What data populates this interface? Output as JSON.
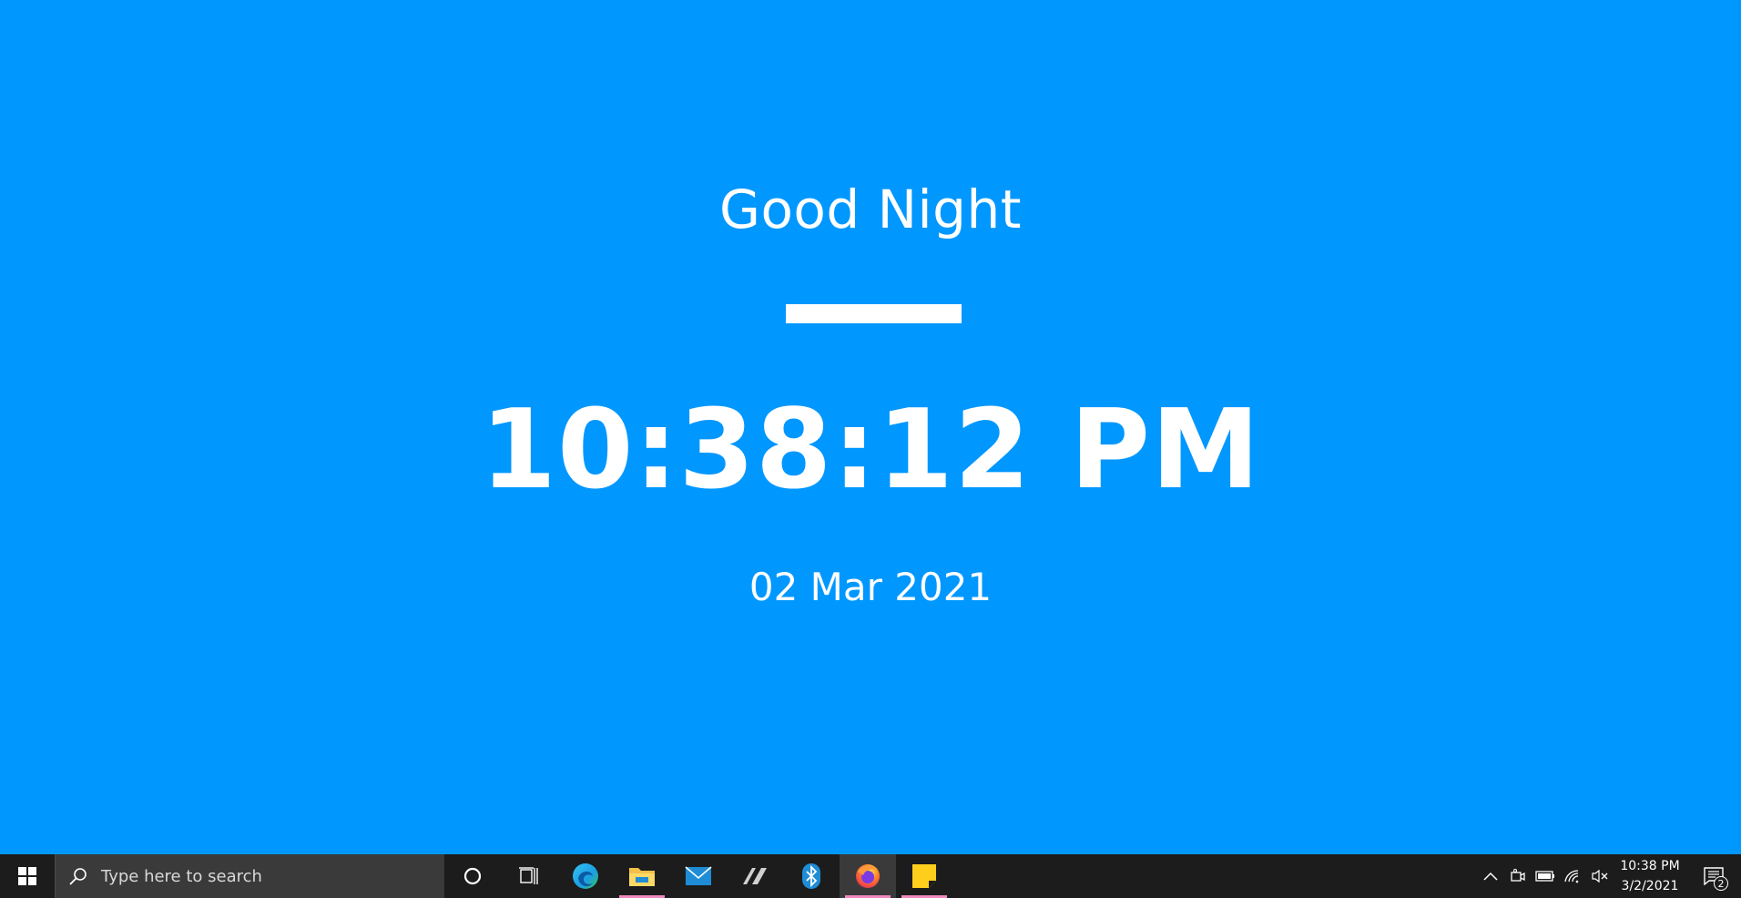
{
  "clock_app": {
    "greeting": "Good Night",
    "time": "10:38:12 PM",
    "date": "02 Mar 2021",
    "background_color": "#0097FF",
    "text_color": "#FFFFFF"
  },
  "taskbar": {
    "search_placeholder": "Type here to search",
    "pinned_apps": [
      {
        "name": "Cortana",
        "icon": "cortana-circle-icon",
        "running": false
      },
      {
        "name": "Task View",
        "icon": "task-view-icon",
        "running": false
      },
      {
        "name": "Microsoft Edge",
        "icon": "edge-icon",
        "running": false
      },
      {
        "name": "File Explorer",
        "icon": "folder-icon",
        "running": true
      },
      {
        "name": "Mail",
        "icon": "mail-icon",
        "running": false
      },
      {
        "name": "App",
        "icon": "slash-app-icon",
        "running": false
      },
      {
        "name": "Bluetooth",
        "icon": "bluetooth-icon",
        "running": false
      },
      {
        "name": "Firefox",
        "icon": "firefox-icon",
        "running": true,
        "active": true
      },
      {
        "name": "Sticky Notes",
        "icon": "sticky-notes-icon",
        "running": true
      }
    ],
    "tray": {
      "time": "10:38 PM",
      "date": "3/2/2021",
      "notification_count": "2",
      "icons": [
        "chevron-up-icon",
        "meet-now-icon",
        "battery-icon",
        "wifi-icon",
        "volume-muted-icon"
      ]
    },
    "accent_underline_color": "#F089C0"
  }
}
